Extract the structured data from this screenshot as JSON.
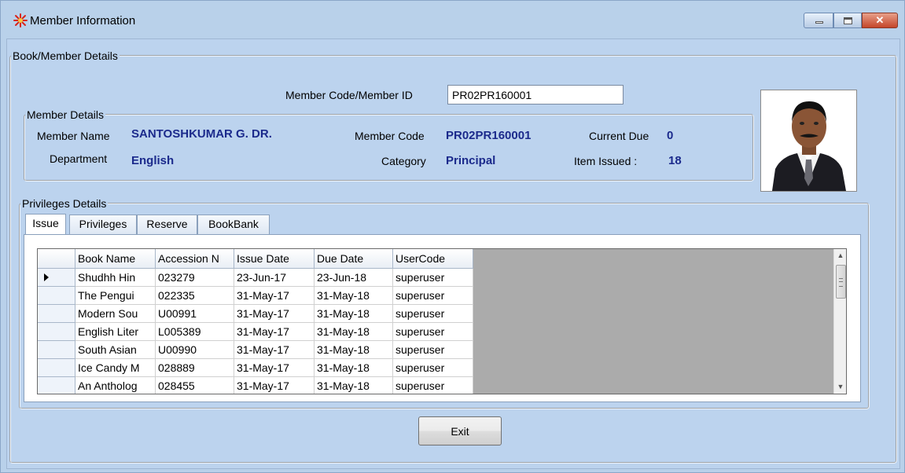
{
  "window": {
    "title": "Member Information",
    "icon": "red-star-app-icon",
    "controls": {
      "minimize": "minimize-icon",
      "maximize": "maximize-icon",
      "close": "close-icon",
      "close_glyph": "✕"
    }
  },
  "book_member_group": {
    "legend": "Book/Member Details"
  },
  "member_code_field": {
    "label": "Member Code/Member ID",
    "value": "PR02PR160001"
  },
  "member_details": {
    "legend": "Member Details",
    "name_label": "Member Name",
    "name_value": "SANTOSHKUMAR  G. DR.",
    "member_code_label": "Member Code",
    "member_code_value": "PR02PR160001",
    "current_due_label": "Current Due",
    "current_due_value": "0",
    "department_label": "Department",
    "department_value": "English",
    "category_label": "Category",
    "category_value": "Principal",
    "items_issued_label": "Item Issued :",
    "items_issued_value": "18"
  },
  "privileges": {
    "legend": "Privileges Details",
    "tabs": [
      {
        "label": "Issue",
        "active": true
      },
      {
        "label": "Privileges",
        "active": false
      },
      {
        "label": "Reserve",
        "active": false
      },
      {
        "label": "BookBank",
        "active": false
      }
    ],
    "grid": {
      "columns": [
        "Book Name",
        "Accession N",
        "Issue Date",
        "Due Date",
        "UserCode"
      ],
      "rows": [
        [
          "Shudhh Hin",
          "023279",
          "23-Jun-17",
          "23-Jun-18",
          "superuser"
        ],
        [
          "The Pengui",
          "022335",
          "31-May-17",
          "31-May-18",
          "superuser"
        ],
        [
          "Modern Sou",
          "U00991",
          "31-May-17",
          "31-May-18",
          "superuser"
        ],
        [
          "English Liter",
          "L005389",
          "31-May-17",
          "31-May-18",
          "superuser"
        ],
        [
          "South Asian",
          "U00990",
          "31-May-17",
          "31-May-18",
          "superuser"
        ],
        [
          "Ice Candy M",
          "028889",
          "31-May-17",
          "31-May-18",
          "superuser"
        ],
        [
          "An Antholog",
          "028455",
          "31-May-17",
          "31-May-18",
          "superuser"
        ]
      ],
      "selected_row": 0
    }
  },
  "buttons": {
    "exit_label": "Exit"
  },
  "colors": {
    "window_bg": "#b9d1ea",
    "value_text": "#1b2a8c"
  }
}
